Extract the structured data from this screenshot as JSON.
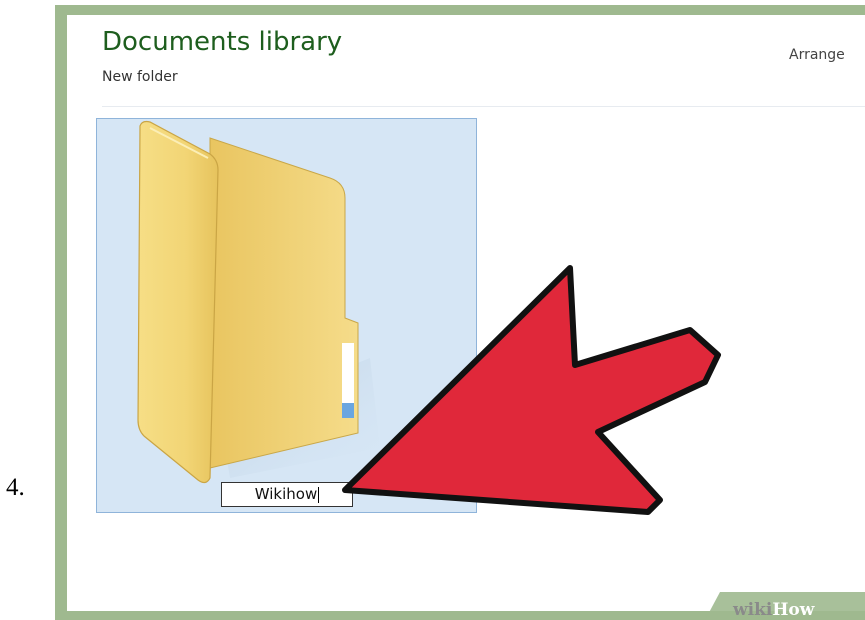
{
  "step": {
    "number": "4."
  },
  "window": {
    "title": "Documents library",
    "subtitle": "New folder",
    "arrange_label": "Arrange"
  },
  "folder": {
    "name_value": "Wikihow"
  },
  "watermark": {
    "wiki": "wiki",
    "how": "How"
  },
  "colors": {
    "frame_green": "#9fb98f",
    "title_green": "#1e5e1e",
    "selection_blue": "#d6e6f5",
    "arrow_red": "#e0283a"
  },
  "icons": [
    "folder-icon",
    "pointer-arrow-icon"
  ]
}
